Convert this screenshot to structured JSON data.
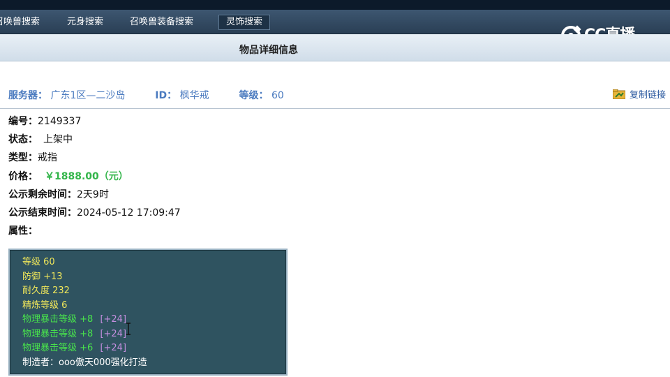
{
  "tabs": [
    {
      "label": "召唤兽搜索"
    },
    {
      "label": "元身搜索"
    },
    {
      "label": "召唤兽装备搜索"
    },
    {
      "label": "灵饰搜索",
      "active": true
    }
  ],
  "watermark": {
    "text": "CC直播"
  },
  "page_title": "物品详细信息",
  "server_info": {
    "server_label": "服务器：",
    "server_value": "广东1区—二沙岛",
    "id_label": "ID：",
    "id_value": "枫华戒",
    "level_label": "等级：",
    "level_value": "60"
  },
  "copy_link": "复制链接",
  "fields": {
    "number_label": "编号：",
    "number_value": "2149337",
    "status_label": "状态：",
    "status_value": "上架中",
    "type_label": "类型：",
    "type_value": "戒指",
    "price_label": "价格：",
    "price_value": "￥1888.00（元）",
    "remaining_label": "公示剩余时间：",
    "remaining_value": "2天9时",
    "end_label": "公示结束时间：",
    "end_value": "2024-05-12 17:09:47",
    "attr_label": "属性："
  },
  "attributes": {
    "level": "等级 60",
    "defense": "防御 +13",
    "durability": "耐久度 232",
    "refine": "精炼等级 6",
    "crit1": "物理暴击等级 +8",
    "crit1_bonus": "[+24]",
    "crit2": "物理暴击等级 +8",
    "crit2_bonus": "[+24]",
    "crit3": "物理暴击等级 +6",
    "crit3_bonus": "[+24]",
    "maker": "制造者：ooo傲天000强化打造"
  },
  "colors": {
    "accent_blue": "#4a7abf",
    "price_green": "#33b54a",
    "attr_yellow": "#f2e85a",
    "attr_green": "#48e24c",
    "attr_purple": "#c58fe0"
  }
}
